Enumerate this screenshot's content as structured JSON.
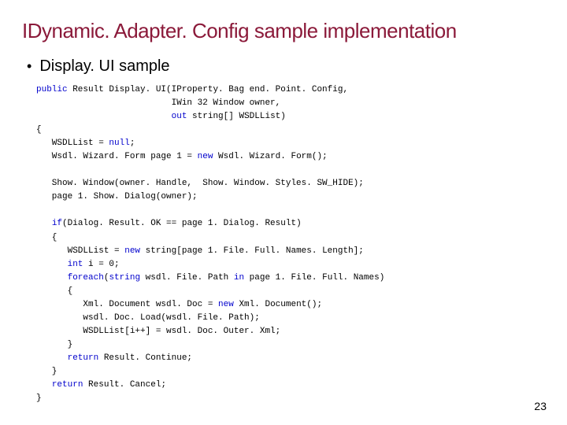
{
  "title": "IDynamic. Adapter. Config sample implementation",
  "bullet": "Display. UI sample",
  "page_number": "23",
  "code": {
    "l01a": "public",
    "l01b": " Result Display. UI(IProperty. Bag end. Point. Config,",
    "l02": "                          IWin 32 Window owner,",
    "l03a": "                          ",
    "l03b": "out",
    "l03c": " string[] WSDLList)",
    "l04": "{",
    "l05a": "   WSDLList = ",
    "l05b": "null",
    "l05c": ";",
    "l06a": "   Wsdl. Wizard. Form page 1 = ",
    "l06b": "new",
    "l06c": " Wsdl. Wizard. Form();",
    "blank1": " ",
    "l07": "   Show. Window(owner. Handle,  Show. Window. Styles. SW_HIDE);",
    "l08": "   page 1. Show. Dialog(owner);",
    "blank2": " ",
    "l09a": "   ",
    "l09b": "if",
    "l09c": "(Dialog. Result. OK == page 1. Dialog. Result)",
    "l10": "   {",
    "l11a": "      WSDLList = ",
    "l11b": "new",
    "l11c": " string[page 1. File. Full. Names. Length];",
    "l12a": "      ",
    "l12b": "int",
    "l12c": " i = 0;",
    "l13a": "      ",
    "l13b": "foreach",
    "l13c": "(",
    "l13d": "string",
    "l13e": " wsdl. File. Path ",
    "l13f": "in",
    "l13g": " page 1. File. Full. Names)",
    "l14": "      {",
    "l15a": "         Xml. Document wsdl. Doc = ",
    "l15b": "new",
    "l15c": " Xml. Document();",
    "l16": "         wsdl. Doc. Load(wsdl. File. Path);",
    "l17": "         WSDLList[i++] = wsdl. Doc. Outer. Xml;",
    "l18": "      }",
    "l19a": "      ",
    "l19b": "return",
    "l19c": " Result. Continue;",
    "l20": "   }",
    "l21a": "   ",
    "l21b": "return",
    "l21c": " Result. Cancel;",
    "l22": "}"
  }
}
